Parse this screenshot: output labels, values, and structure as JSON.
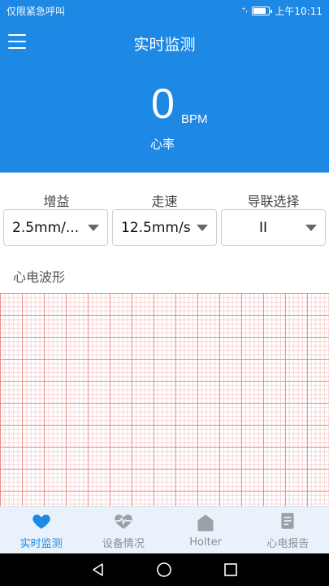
{
  "status_bar": {
    "carrier": "仅限紧急呼叫",
    "time": "上午10:11"
  },
  "header": {
    "title": "实时监测",
    "heart_rate_value": "0",
    "heart_rate_unit": "BPM",
    "heart_rate_label": "心率"
  },
  "settings": {
    "gain": {
      "label": "增益",
      "value": "2.5mm/..."
    },
    "speed": {
      "label": "走速",
      "value": "12.5mm/s"
    },
    "lead": {
      "label": "导联选择",
      "value": "II"
    }
  },
  "waveform": {
    "title": "心电波形"
  },
  "bottom_nav": [
    {
      "label": "实时监测",
      "icon": "heart-icon",
      "active": true
    },
    {
      "label": "设备情况",
      "icon": "heartbeat-icon",
      "active": false
    },
    {
      "label": "Holter",
      "icon": "home-icon",
      "active": false
    },
    {
      "label": "心电报告",
      "icon": "report-icon",
      "active": false
    }
  ],
  "colors": {
    "primary": "#1e88e5",
    "nav_bg": "#e9f2fb",
    "grid": "#eb7878",
    "inactive": "#8a8f95"
  }
}
